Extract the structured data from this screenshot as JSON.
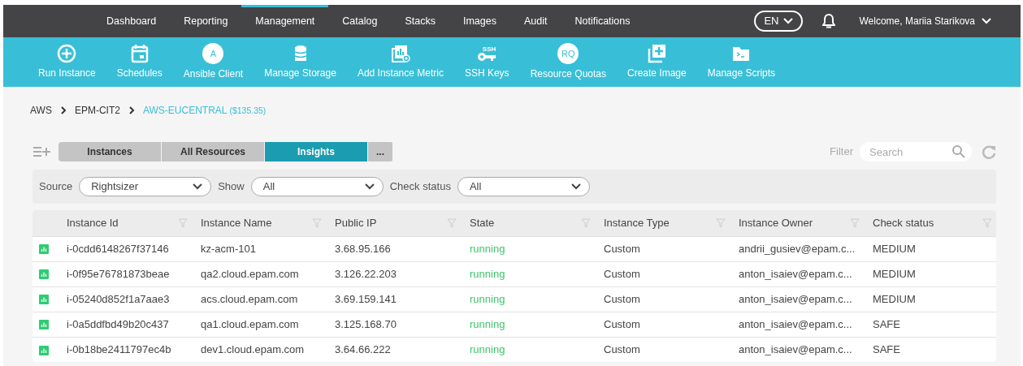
{
  "top_nav": {
    "items": [
      {
        "label": "Dashboard",
        "selected": false
      },
      {
        "label": "Reporting",
        "selected": false
      },
      {
        "label": "Management",
        "selected": true
      },
      {
        "label": "Catalog",
        "selected": false
      },
      {
        "label": "Stacks",
        "selected": false
      },
      {
        "label": "Images",
        "selected": false
      },
      {
        "label": "Audit",
        "selected": false
      },
      {
        "label": "Notifications",
        "selected": false
      }
    ],
    "language": "EN",
    "user": "Welcome, Mariia Starikova"
  },
  "toolbar": [
    {
      "label": "Run Instance",
      "kind": "plus"
    },
    {
      "label": "Schedules",
      "kind": "calendar"
    },
    {
      "label": "Ansible Client",
      "kind": "letter",
      "badge": "A"
    },
    {
      "label": "Manage Storage",
      "kind": "database"
    },
    {
      "label": "Add Instance Metric",
      "kind": "metric"
    },
    {
      "label": "SSH Keys",
      "kind": "key",
      "badge": "SSH"
    },
    {
      "label": "Resource Quotas",
      "kind": "letter",
      "badge": "RQ"
    },
    {
      "label": "Create Image",
      "kind": "image"
    },
    {
      "label": "Manage Scripts",
      "kind": "folder"
    }
  ],
  "breadcrumbs": [
    {
      "label": "AWS",
      "selected": false
    },
    {
      "label": "EPM-CIT2",
      "selected": false
    },
    {
      "label": "AWS-EUCENTRAL",
      "note": "($135.35)",
      "selected": true
    }
  ],
  "tabs": [
    {
      "label": "Instances",
      "selected": false
    },
    {
      "label": "All Resources",
      "selected": false
    },
    {
      "label": "Insights",
      "selected": true
    },
    {
      "label": "...",
      "selected": false
    }
  ],
  "filter": {
    "label": "Filter",
    "placeholder": "Search"
  },
  "filters": [
    {
      "label": "Source",
      "value": "Rightsizer"
    },
    {
      "label": "Show",
      "value": "All"
    },
    {
      "label": "Check status",
      "value": "All"
    }
  ],
  "table": {
    "columns": [
      "Instance Id",
      "Instance Name",
      "Public IP",
      "State",
      "Instance Type",
      "Instance Owner",
      "Check status"
    ],
    "rows": [
      {
        "cells": [
          "i-0cdd6148267f37146",
          "kz-acm-101",
          "3.68.95.166",
          "running",
          "Custom",
          "andrii_gusiev@epam.c...",
          "MEDIUM"
        ]
      },
      {
        "cells": [
          "i-0f95e76781873beae",
          "qa2.cloud.epam.com",
          "3.126.22.203",
          "running",
          "Custom",
          "anton_isaiev@epam.c...",
          "MEDIUM"
        ]
      },
      {
        "cells": [
          "i-05240d852f1a7aae3",
          "acs.cloud.epam.com",
          "3.69.159.141",
          "running",
          "Custom",
          "anton_isaiev@epam.c...",
          "MEDIUM"
        ]
      },
      {
        "cells": [
          "i-0a5ddfbd49b20c437",
          "qa1.cloud.epam.com",
          "3.125.168.70",
          "running",
          "Custom",
          "anton_isaiev@epam.c...",
          "SAFE"
        ]
      },
      {
        "cells": [
          "i-0b18be2411797ec4b",
          "dev1.cloud.epam.com",
          "3.64.66.222",
          "running",
          "Custom",
          "anton_isaiev@epam.c...",
          "SAFE"
        ]
      }
    ]
  }
}
